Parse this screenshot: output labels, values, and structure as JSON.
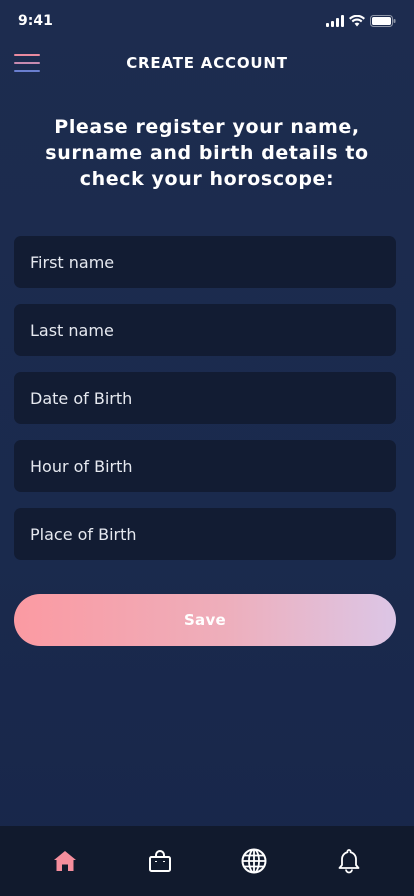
{
  "status_bar": {
    "time": "9:41"
  },
  "header": {
    "title": "CREATE ACCOUNT"
  },
  "intro": {
    "text": "Please register your name, surname and birth details to check your horoscope:"
  },
  "form": {
    "first_name_placeholder": "First name",
    "last_name_placeholder": "Last name",
    "date_of_birth_placeholder": "Date of Birth",
    "hour_of_birth_placeholder": "Hour of Birth",
    "place_of_birth_placeholder": "Place of Birth"
  },
  "save_label": "Save",
  "tab_bar": {
    "items": [
      {
        "icon": "home-icon",
        "active": true
      },
      {
        "icon": "shopping-bag-icon",
        "active": false
      },
      {
        "icon": "globe-icon",
        "active": false
      },
      {
        "icon": "bell-icon",
        "active": false
      }
    ]
  },
  "colors": {
    "background": "#1d2c4f",
    "field": "#121c33",
    "tab_bar": "#111a2d",
    "active_tab": "#f58e9d",
    "save_gradient_start": "#fb9aa2",
    "save_gradient_end": "#dcc6e6"
  }
}
